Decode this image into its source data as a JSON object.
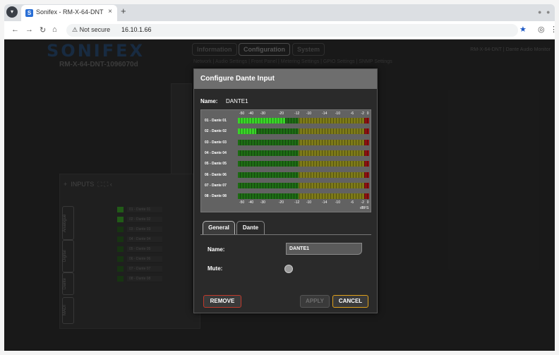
{
  "browser": {
    "tab_title": "Sonifex - RM-X-64-DNT",
    "tab_favicon": "S",
    "close_glyph": "×",
    "new_tab_glyph": "+",
    "security_label": "⚠ Not secure",
    "url": "16.10.1.66"
  },
  "app": {
    "logo": "SONIFEX",
    "device_name": "RM-X-64-DNT-1096070d",
    "tabs": [
      "Information",
      "Configuration",
      "System"
    ],
    "active_tab": "Configuration",
    "header_right": "RM-X-64-DNT | Dante Audio Monitor",
    "subnav": "Network | Audio Settings | Front Panel | Metering Settings | GPIO Settings | SNMP Settings",
    "inputs_header": "INPUTS",
    "side_tabs": [
      "Analogue",
      "Digital",
      "Dante",
      "MADI"
    ],
    "bg_rows": [
      "01 - Dante 01",
      "02 - Dante 02",
      "03 - Dante 03",
      "04 - Dante 04",
      "05 - Dante 05",
      "06 - Dante 06",
      "07 - Dante 07",
      "08 - Dante 08"
    ]
  },
  "dialog": {
    "title": "Configure Dante Input",
    "name_label": "Name:",
    "name_value": "DANTE1",
    "meter": {
      "scale": [
        "-50",
        "-40",
        "-30",
        "-20",
        "-12",
        "-10",
        "-14",
        "-10",
        "-6",
        "-2",
        "0"
      ],
      "scale_bottom": [
        "-50",
        "-40",
        "-30",
        "-20",
        "-12",
        "-10",
        "-14",
        "-10",
        "-6",
        "-2",
        "0"
      ],
      "unit": "dBFS",
      "channels": [
        {
          "label": "01 - Dante 01",
          "level": 0.36
        },
        {
          "label": "02 - Dante 02",
          "level": 0.14
        },
        {
          "label": "03 - Dante 03",
          "level": 0
        },
        {
          "label": "04 - Dante 04",
          "level": 0
        },
        {
          "label": "05 - Dante 05",
          "level": 0
        },
        {
          "label": "06 - Dante 06",
          "level": 0
        },
        {
          "label": "07 - Dante 07",
          "level": 0
        },
        {
          "label": "08 - Dante 08",
          "level": 0
        }
      ]
    },
    "tabs": {
      "general": "General",
      "dante": "Dante"
    },
    "fields": {
      "name_label": "Name:",
      "name_value": "DANTE1",
      "mute_label": "Mute:"
    },
    "buttons": {
      "remove": "REMOVE",
      "apply": "APPLY",
      "cancel": "CANCEL"
    }
  },
  "colors": {
    "meter_green": "#39d428",
    "meter_dark_green": "#1d6b14",
    "meter_olive": "#7d7a18",
    "meter_red": "#8c1010",
    "remove_border": "#c0392b",
    "cancel_border": "#e0a11b"
  }
}
